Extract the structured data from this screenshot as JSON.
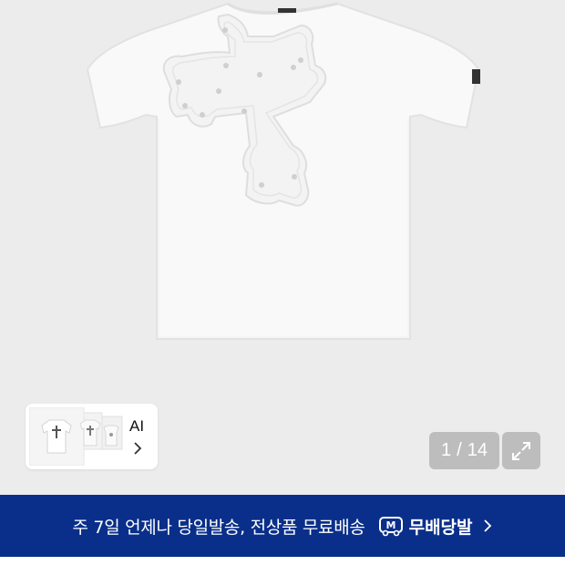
{
  "gallery": {
    "current": "1",
    "separator": "/",
    "total": "14"
  },
  "ai_card": {
    "label": "AI"
  },
  "promo": {
    "text": "주 7일 언제나 당일발송, 전상품 무료배송",
    "badge_icon_letter": "M",
    "badge_label": "무배당발"
  },
  "icons": {
    "expand": "expand-icon",
    "chevron": "chevron-right-icon"
  },
  "colors": {
    "banner_bg": "#0a2f8a",
    "image_bg": "#ececec",
    "counter_bg": "#bdbdbd"
  }
}
